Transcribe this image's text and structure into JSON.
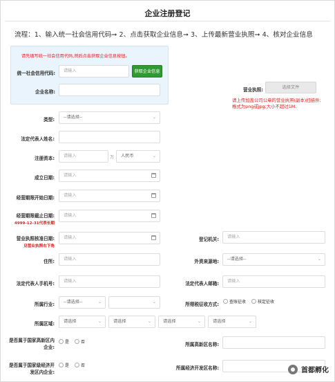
{
  "page": {
    "title": "企业注册登记",
    "flow": "流程：1、输入统一社会信用代码➞ 2、点击获取企业信息➞ 3、上传最新营业执照➞ 4、核对企业信息"
  },
  "lookup": {
    "warning": "请先填写统一社会信用代码,然后点击获取企业信息按钮。",
    "credit_code_label": "统一社会信用代码:",
    "credit_code_placeholder": "请输入",
    "fetch_button": "获取企业信息",
    "company_name_label": "企业名称:",
    "company_name_value": ""
  },
  "license": {
    "label": "营业执照:",
    "choose_button": "选择文件",
    "hint_line1": "请上传加盖公司公章的营业执照(副本)扫描件;",
    "hint_line2": "格式为png或jpg;大小不超过1M."
  },
  "form": {
    "type_label": "类型:",
    "type_value": "--请选择--",
    "legal_rep_label": "法定代表人姓名:",
    "legal_rep_value": "",
    "capital_label": "注册资本:",
    "capital_placeholder": "请输入",
    "capital_unit": "万",
    "currency_value": "人民币",
    "founded_label": "成立日期:",
    "founded_placeholder": "请输入",
    "op_start_label": "经营期限开始日期:",
    "op_start_placeholder": "请输入",
    "op_end_label": "经营期限截止日期:",
    "op_end_note": "4999-12-31代表长期",
    "op_end_placeholder": "请输入",
    "license_issue_label": "营业执照核准日期:",
    "license_issue_note": "见营业执照右下角",
    "license_issue_placeholder": "请输入",
    "reg_authority_label": "登记机关:",
    "reg_authority_placeholder": "请输入",
    "address_label": "住所:",
    "address_placeholder": "请输入",
    "foreign_source_label": "外资来源地:",
    "foreign_source_value": "--请选择--",
    "legal_phone_label": "法定代表人手机号:",
    "legal_phone_placeholder": "请输入",
    "legal_email_label": "法定代表人邮箱:",
    "legal_email_placeholder": "请输入",
    "industry_label": "所属行业:",
    "industry_value": "--请选择--",
    "industry_sub_value": "",
    "tax_method_label": "所得税征收方式:",
    "tax_option_1": "查账征收",
    "tax_option_2": "核定征收",
    "region_label": "所属区域:",
    "region_1": "请选择",
    "region_2": "请选择",
    "region_3": "请选择",
    "region_4": "请选择",
    "high_tech_zone_label_1": "是否属于国家高新区内",
    "high_tech_zone_label_2": "企业:",
    "yes": "是",
    "no": "否",
    "high_tech_zone_name_label": "所属高新区名称:",
    "high_tech_zone_name_value": "",
    "econ_zone_label_1": "是否属于国家级经济开",
    "econ_zone_label_2": "发区内企业:",
    "econ_zone_name_label": "所属经济开发区名称:",
    "econ_zone_name_value": ""
  },
  "watermark": {
    "text": "首都孵化"
  }
}
